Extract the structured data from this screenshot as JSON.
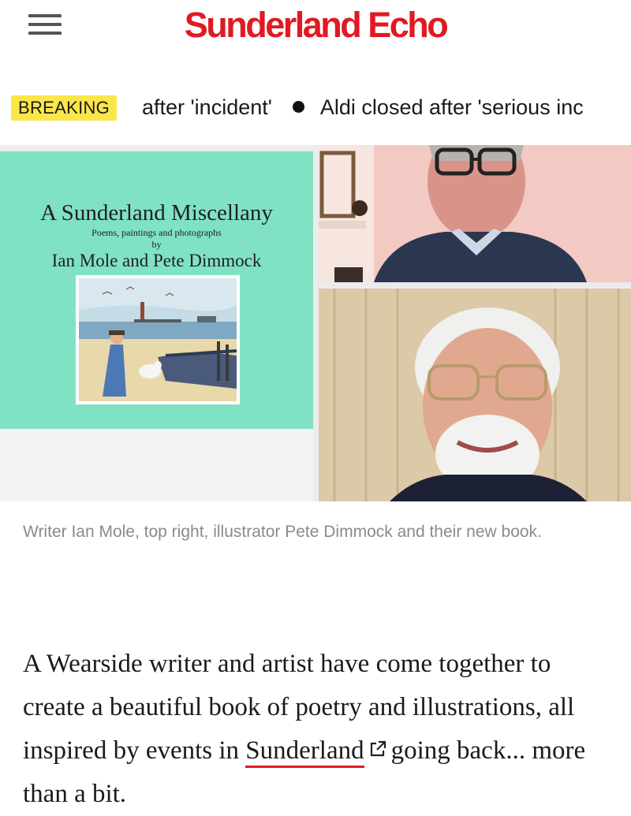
{
  "header": {
    "logo_text": "Sunderland Echo",
    "menu_icon": "hamburger-menu-icon"
  },
  "breaking": {
    "badge": "BREAKING",
    "items": [
      "after 'incident'",
      "Aldi closed after 'serious inc"
    ]
  },
  "hero": {
    "book_title": "A Sunderland Miscellany",
    "book_subtitle": "Poems, paintings and photographs",
    "book_by": "by",
    "book_authors": "Ian Mole and Pete Dimmock",
    "signature": "Pete Dimmock"
  },
  "caption": "Writer Ian Mole, top right, illustrator Pete Dimmock and their new book.",
  "article": {
    "text_before": "A Wearside writer and artist have come together to create a beautiful book of poetry and illustrations, all inspired by events in ",
    "link_text": "Sunderland",
    "link_icon": "external-link-icon",
    "text_after": "going back... more than a bit."
  },
  "colors": {
    "brand_red": "#e01a22",
    "breaking_yellow": "#fbe64a",
    "book_cover_green": "#7fe2c4"
  }
}
